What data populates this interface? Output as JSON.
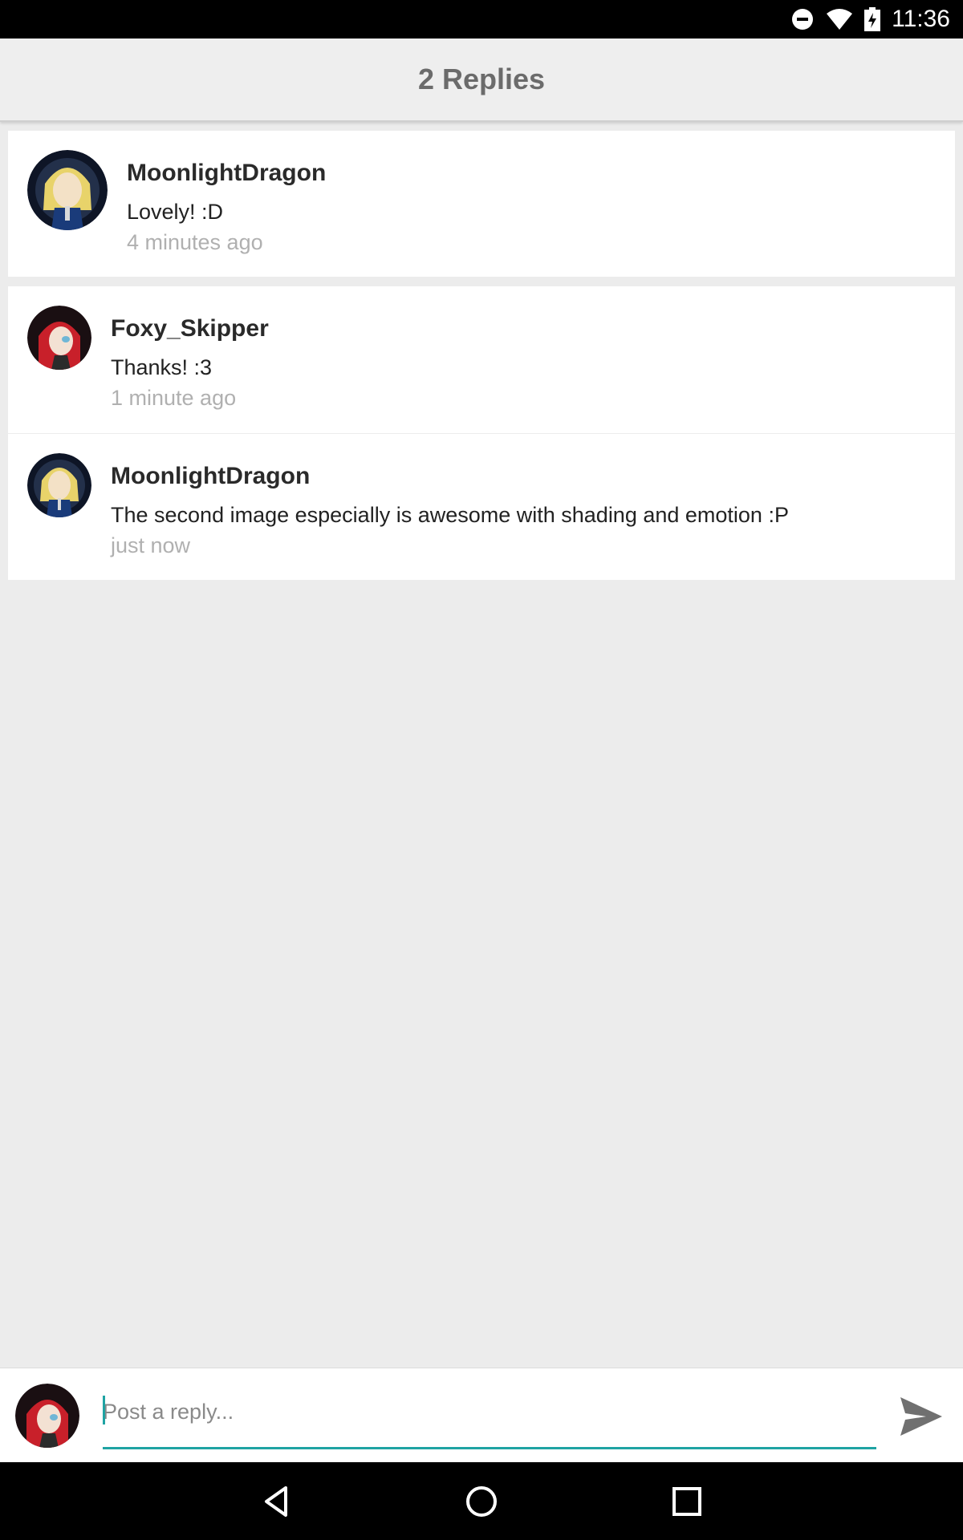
{
  "status_bar": {
    "time": "11:36",
    "icons": [
      "do-not-disturb-icon",
      "wifi-icon",
      "battery-charging-icon"
    ]
  },
  "header": {
    "title": "2 Replies"
  },
  "parent_comment": {
    "username": "MoonlightDragon",
    "body": "Lovely! :D",
    "time": "4 minutes ago",
    "avatar": "avatar-blonde-character"
  },
  "replies": [
    {
      "username": "Foxy_Skipper",
      "body": "Thanks! :3",
      "time": "1 minute ago",
      "avatar": "avatar-redhead-character"
    },
    {
      "username": "MoonlightDragon",
      "body": "The second image especially is awesome with shading and emotion :P",
      "time": "just now",
      "avatar": "avatar-blonde-character"
    }
  ],
  "reply_bar": {
    "placeholder": "Post a reply...",
    "value": "",
    "send_icon": "send-icon",
    "accent": "#1fa3a3"
  },
  "nav_bar": {
    "icons": [
      "back-icon",
      "home-icon",
      "recents-icon"
    ]
  }
}
